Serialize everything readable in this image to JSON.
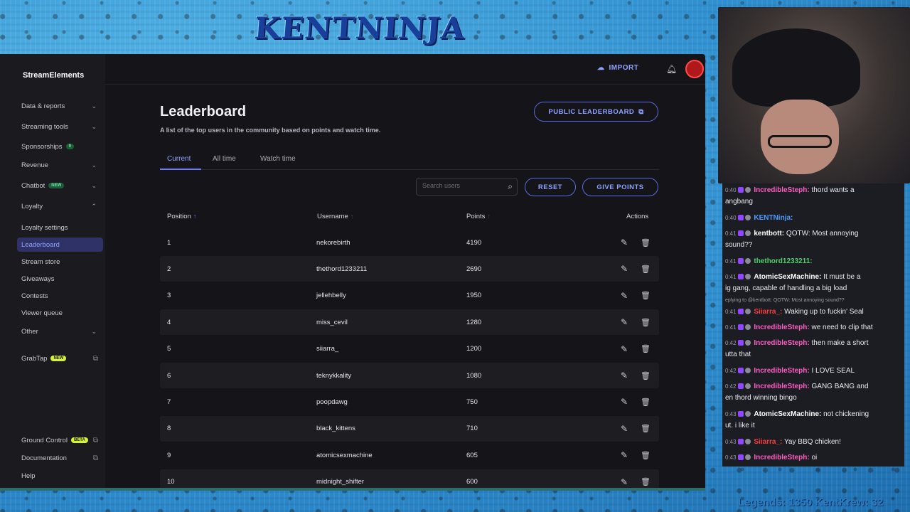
{
  "overlay": {
    "logo_text": "KENTNINJA",
    "ticker": "Legends: 1350 KentKrew: 32"
  },
  "sidebar": {
    "logo": "StreamElements",
    "items": [
      {
        "label": "Data & reports",
        "chevron": "down"
      },
      {
        "label": "Streaming tools",
        "chevron": "down"
      },
      {
        "label": "Sponsorships",
        "badge": "9"
      },
      {
        "label": "Revenue",
        "chevron": "down"
      },
      {
        "label": "Chatbot",
        "badge": "NEW",
        "chevron": "down"
      },
      {
        "label": "Loyalty",
        "chevron": "up"
      },
      {
        "label": "Loyalty settings"
      },
      {
        "label": "Leaderboard",
        "active": true
      },
      {
        "label": "Stream store"
      },
      {
        "label": "Giveaways"
      },
      {
        "label": "Contests"
      },
      {
        "label": "Viewer queue"
      },
      {
        "label": "Other",
        "chevron": "down"
      },
      {
        "label": "GrabTap",
        "badge": "NEW"
      },
      {
        "label": "Ground Control",
        "badge": "BETA"
      },
      {
        "label": "Documentation"
      },
      {
        "label": "Help"
      }
    ]
  },
  "topbar": {
    "import_label": "IMPORT"
  },
  "page": {
    "title": "Leaderboard",
    "subtitle": "A list of the top users in the community based on points and watch time.",
    "public_button": "PUBLIC LEADERBOARD",
    "tabs": [
      {
        "label": "Current",
        "active": true
      },
      {
        "label": "All time"
      },
      {
        "label": "Watch time"
      }
    ],
    "search_placeholder": "Search users",
    "reset_label": "RESET",
    "give_points_label": "GIVE POINTS",
    "columns": [
      "Position",
      "Username",
      "Points",
      "Actions"
    ],
    "rows": [
      {
        "position": "1",
        "username": "nekorebirth",
        "points": "4190"
      },
      {
        "position": "2",
        "username": "thethord1233211",
        "points": "2690"
      },
      {
        "position": "3",
        "username": "jellehbelly",
        "points": "1950"
      },
      {
        "position": "4",
        "username": "miss_cevil",
        "points": "1280"
      },
      {
        "position": "5",
        "username": "siiarra_",
        "points": "1200"
      },
      {
        "position": "6",
        "username": "teknykkality",
        "points": "1080"
      },
      {
        "position": "7",
        "username": "poopdawg",
        "points": "750"
      },
      {
        "position": "8",
        "username": "black_kittens",
        "points": "710"
      },
      {
        "position": "9",
        "username": "atomicsexmachine",
        "points": "605"
      },
      {
        "position": "10",
        "username": "midnight_shifter",
        "points": "600"
      }
    ]
  },
  "chat": {
    "messages": [
      {
        "time": "0:40",
        "name": "IncredibleSteph:",
        "name_color": "#ff5cc6",
        "text": "thord wants a",
        "cont": "angbang"
      },
      {
        "time": "0:40",
        "name": "KENTNinja:",
        "name_color": "#4f9bff",
        "text": ""
      },
      {
        "time": "0:41",
        "name": "kentbott:",
        "name_color": "#ffffff",
        "text": "QOTW: Most annoying",
        "cont": "sound??"
      },
      {
        "time": "0:41",
        "name": "thethord1233211:",
        "name_color": "#4ccf6a",
        "text": ""
      },
      {
        "time": "0:41",
        "name": "AtomicSexMachine:",
        "name_color": "#ffffff",
        "text": "It must be a",
        "cont": "ig gang, capable of handling a big load",
        "reply": "eplying to @kentbott: QOTW: Most annoying sound??"
      },
      {
        "time": "0:41",
        "name": "Siiarra_:",
        "name_color": "#ff3b3b",
        "text": "Waking up to fuckin' Seal"
      },
      {
        "time": "0:41",
        "name": "IncredibleSteph:",
        "name_color": "#ff5cc6",
        "text": "we need to clip that"
      },
      {
        "time": "0:42",
        "name": "IncredibleSteph:",
        "name_color": "#ff5cc6",
        "text": "then make a short",
        "cont": "utta that"
      },
      {
        "time": "0:42",
        "name": "IncredibleSteph:",
        "name_color": "#ff5cc6",
        "text": "I LOVE SEAL"
      },
      {
        "time": "0:42",
        "name": "IncredibleSteph:",
        "name_color": "#ff5cc6",
        "text": "GANG BANG and",
        "cont": "en thord winning bingo"
      },
      {
        "time": "0:43",
        "name": "AtomicSexMachine:",
        "name_color": "#ffffff",
        "text": "not chickening",
        "cont": "ut. i like it"
      },
      {
        "time": "0:43",
        "name": "Siiarra_:",
        "name_color": "#ff3b3b",
        "text": "Yay BBQ chicken!"
      },
      {
        "time": "0:43",
        "name": "IncredibleSteph:",
        "name_color": "#ff5cc6",
        "text": "oi"
      }
    ]
  }
}
